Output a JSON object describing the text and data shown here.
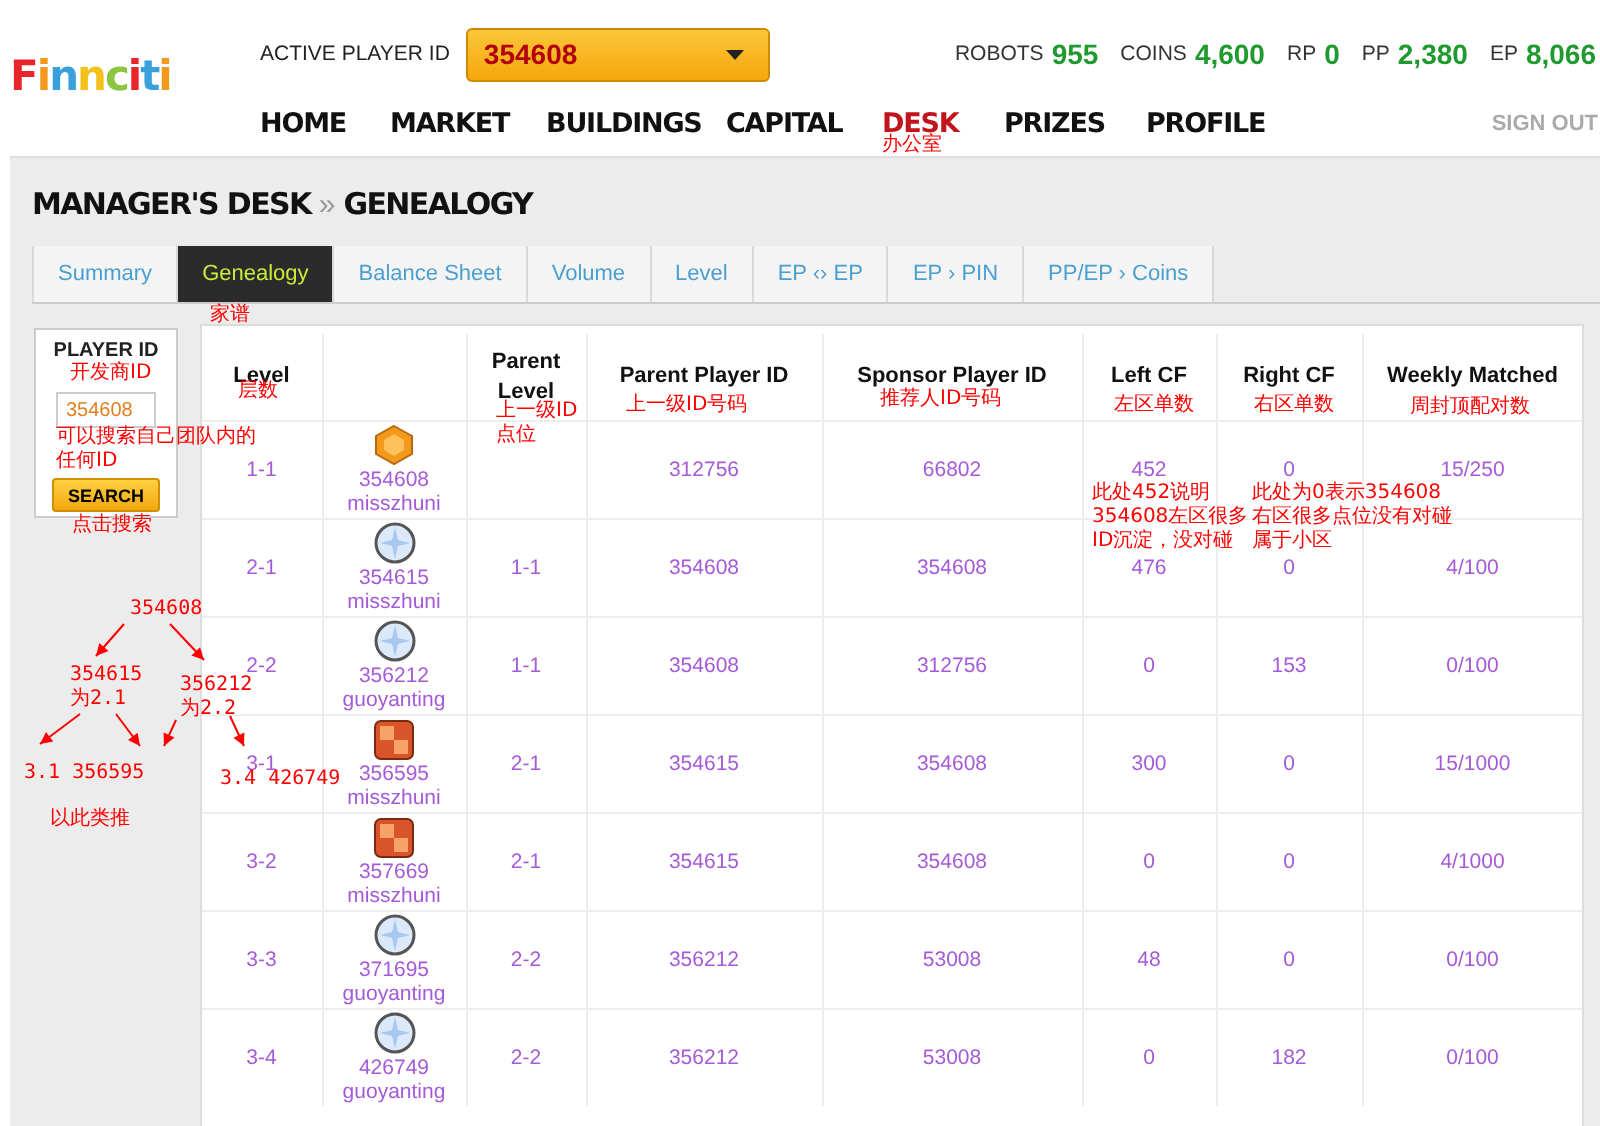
{
  "header": {
    "logo": "Finnciti",
    "active_player_label": "ACTIVE PLAYER ID",
    "active_player_value": "354608",
    "stats": [
      {
        "label": "ROBOTS",
        "value": "955"
      },
      {
        "label": "COINS",
        "value": "4,600"
      },
      {
        "label": "RP",
        "value": "0"
      },
      {
        "label": "PP",
        "value": "2,380"
      },
      {
        "label": "EP",
        "value": "8,066"
      }
    ],
    "nav": [
      {
        "label": "HOME",
        "selected": false
      },
      {
        "label": "MARKET",
        "selected": false
      },
      {
        "label": "BUILDINGS",
        "selected": false
      },
      {
        "label": "CAPITAL",
        "selected": false
      },
      {
        "label": "DESK",
        "selected": true
      },
      {
        "label": "PRIZES",
        "selected": false
      },
      {
        "label": "PROFILE",
        "selected": false
      }
    ],
    "sign_out": "SIGN OUT"
  },
  "breadcrumb": {
    "parent": "MANAGER'S DESK",
    "separator": "»",
    "current": "GENEALOGY"
  },
  "tabs": [
    {
      "label": "Summary",
      "selected": false
    },
    {
      "label": "Genealogy",
      "selected": true
    },
    {
      "label": "Balance Sheet",
      "selected": false
    },
    {
      "label": "Volume",
      "selected": false
    },
    {
      "label": "Level",
      "selected": false
    },
    {
      "label": "EP ‹› EP",
      "selected": false
    },
    {
      "label": "EP › PIN",
      "selected": false
    },
    {
      "label": "PP/EP › Coins",
      "selected": false
    }
  ],
  "search_panel": {
    "title": "PLAYER ID",
    "value": "354608",
    "button": "SEARCH"
  },
  "table": {
    "columns": [
      "Level",
      "Parent Level",
      "Parent Player ID",
      "Sponsor Player ID",
      "Left CF",
      "Right CF",
      "Weekly Matched"
    ],
    "rows": [
      {
        "level": "1-1",
        "badge": {
          "kind": "hexagon",
          "id": "354608",
          "name": "misszhuni"
        },
        "parent_level": "",
        "parent_id": "312756",
        "sponsor_id": "66802",
        "left_cf": "452",
        "right_cf": "0",
        "weekly": "15/250"
      },
      {
        "level": "2-1",
        "badge": {
          "kind": "circle",
          "id": "354615",
          "name": "misszhuni"
        },
        "parent_level": "1-1",
        "parent_id": "354608",
        "sponsor_id": "354608",
        "left_cf": "476",
        "right_cf": "0",
        "weekly": "4/100"
      },
      {
        "level": "2-2",
        "badge": {
          "kind": "circle",
          "id": "356212",
          "name": "guoyanting"
        },
        "parent_level": "1-1",
        "parent_id": "354608",
        "sponsor_id": "312756",
        "left_cf": "0",
        "right_cf": "153",
        "weekly": "0/100"
      },
      {
        "level": "3-1",
        "badge": {
          "kind": "square",
          "id": "356595",
          "name": "misszhuni"
        },
        "parent_level": "2-1",
        "parent_id": "354615",
        "sponsor_id": "354608",
        "left_cf": "300",
        "right_cf": "0",
        "weekly": "15/1000"
      },
      {
        "level": "3-2",
        "badge": {
          "kind": "square",
          "id": "357669",
          "name": "misszhuni"
        },
        "parent_level": "2-1",
        "parent_id": "354615",
        "sponsor_id": "354608",
        "left_cf": "0",
        "right_cf": "0",
        "weekly": "4/1000"
      },
      {
        "level": "3-3",
        "badge": {
          "kind": "circle",
          "id": "371695",
          "name": "guoyanting"
        },
        "parent_level": "2-2",
        "parent_id": "356212",
        "sponsor_id": "53008",
        "left_cf": "48",
        "right_cf": "0",
        "weekly": "0/100"
      },
      {
        "level": "3-4",
        "badge": {
          "kind": "circle",
          "id": "426749",
          "name": "guoyanting"
        },
        "parent_level": "2-2",
        "parent_id": "356212",
        "sponsor_id": "53008",
        "left_cf": "0",
        "right_cf": "182",
        "weekly": "0/100"
      }
    ]
  },
  "annotations": [
    "办公室",
    "家谱",
    "开发商ID",
    "可以搜索自己团队内的",
    "任何ID",
    "点击搜索",
    "层数",
    "上一级ID\n点位",
    "上一级ID号码",
    "推荐人ID号码",
    "左区单数",
    "右区单数",
    "周封顶配对数",
    "此处452说明\n354608左区很多\nID沉淀，没对碰",
    "此处为0表示354608",
    "右区很多点位没有对碰",
    "属于小区",
    "354608",
    "354615\n为2.1",
    "356212\n为2.2",
    "3.1 356595",
    "3.4 426749",
    "以此类推"
  ]
}
